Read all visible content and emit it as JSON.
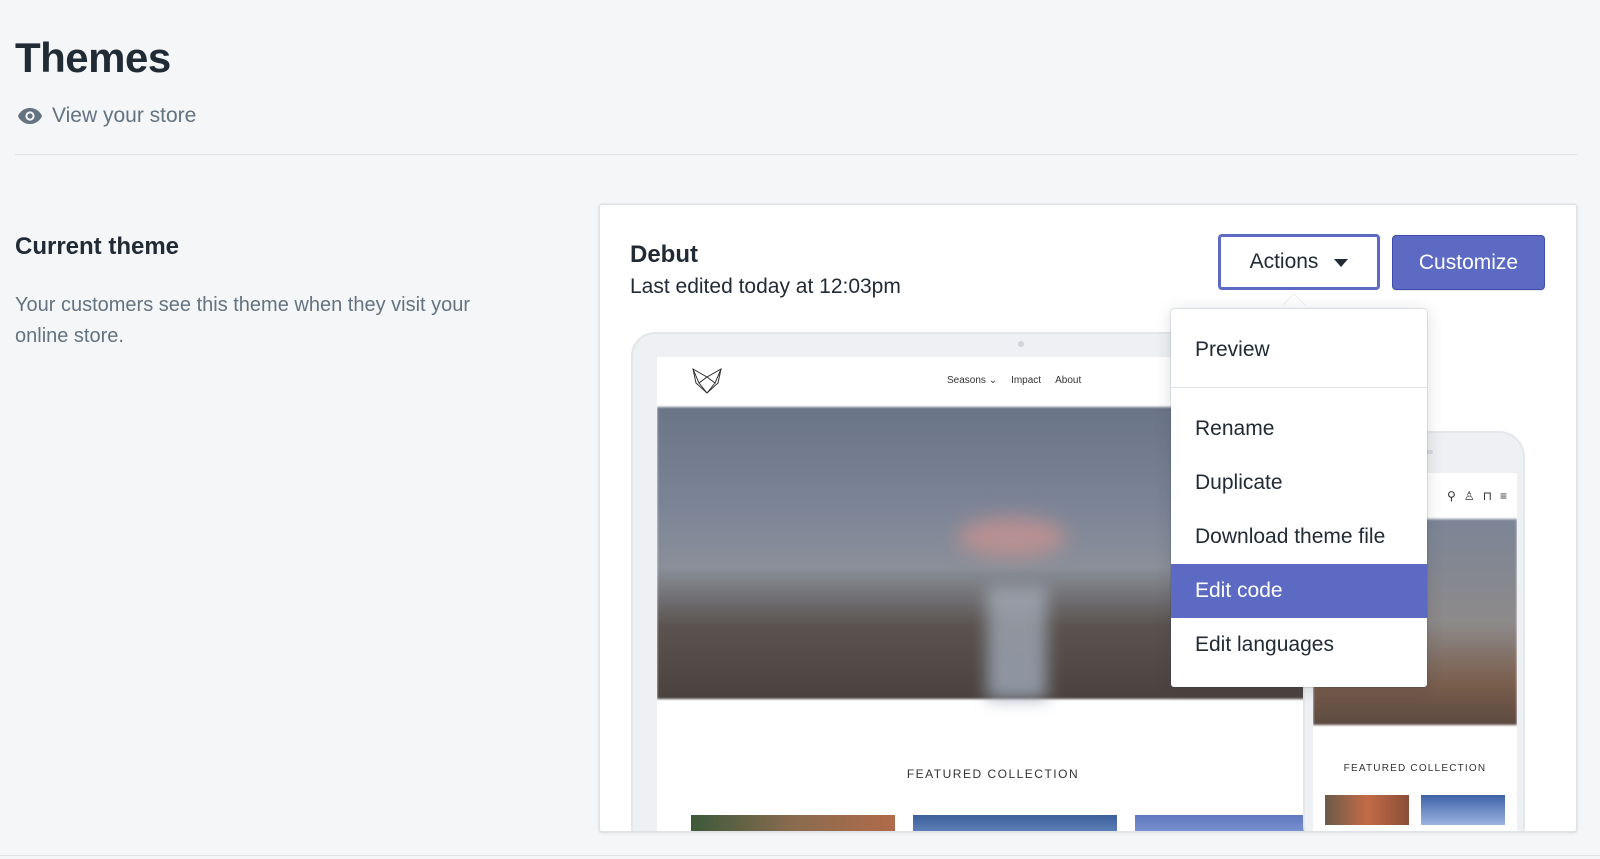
{
  "page": {
    "title": "Themes",
    "view_store_label": "View your store"
  },
  "current_theme_section": {
    "heading": "Current theme",
    "description": "Your customers see this theme when they visit your online store."
  },
  "theme_card": {
    "name": "Debut",
    "last_edited": "Last edited today at 12:03pm",
    "actions_label": "Actions",
    "customize_label": "Customize"
  },
  "preview": {
    "nav_items": [
      "Seasons ⌄",
      "Impact",
      "About"
    ],
    "featured_label": "FEATURED COLLECTION",
    "mobile_featured_label": "FEATURED COLLECTION"
  },
  "actions_menu": {
    "items": [
      {
        "label": "Preview"
      },
      {
        "label": "Rename"
      },
      {
        "label": "Duplicate"
      },
      {
        "label": "Download theme file"
      },
      {
        "label": "Edit code",
        "highlighted": true
      },
      {
        "label": "Edit languages"
      }
    ]
  },
  "colors": {
    "accent": "#5c6ac4",
    "background": "#f4f6f8",
    "text": "#212b36",
    "subdued_text": "#637381"
  }
}
